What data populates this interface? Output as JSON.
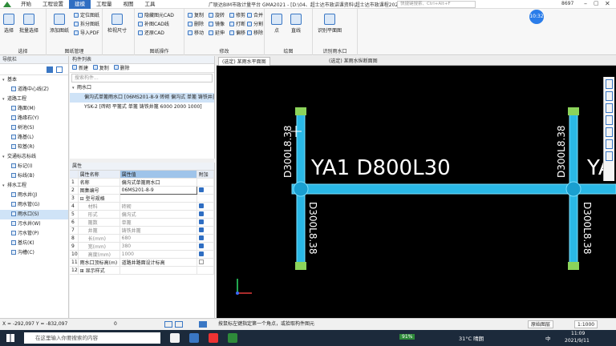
{
  "app": {
    "title": "广联达BIM市政计量平台 GMA2021 - [D:\\04、超士达市政讲课资料\\超士达市政课程2021-8-1\\纬五路管网工程.GMA]",
    "menus": [
      "开始",
      "工程设置",
      "建模",
      "工程量",
      "视图",
      "工具"
    ],
    "active_menu": "建模",
    "search_placeholder": "快捷键搜索、Ctrl+Alt+F",
    "user_id": "8697",
    "timer": "10:32"
  },
  "ribbon": {
    "groups": [
      {
        "label": "选择",
        "buttons": [
          "选择",
          "批量选择"
        ]
      },
      {
        "label": "图纸管理",
        "buttons": [
          "添加图纸",
          "定位图纸",
          "拆分图纸",
          "导入PDF"
        ]
      },
      {
        "label": "",
        "buttons": [
          "检视尺寸"
        ]
      },
      {
        "label": "图纸操作",
        "buttons": [
          "隐藏图元CAD",
          "补图CAD线",
          "还原CAD"
        ]
      },
      {
        "label": "修改",
        "buttons": [
          "复制",
          "旋转",
          "修剪",
          "合并",
          "删除",
          "镜像",
          "打断",
          "分割",
          "移动",
          "延伸",
          "偏移",
          "移除"
        ]
      },
      {
        "label": "绘图",
        "buttons": [
          "点",
          "直线"
        ]
      },
      {
        "label": "识别雨水口",
        "buttons": [
          "识别平面图"
        ]
      }
    ]
  },
  "nav": {
    "title": "导航栏",
    "items": [
      {
        "label": "基本",
        "level": 0
      },
      {
        "label": "道路中心线(Z)",
        "level": 1
      },
      {
        "label": "道路工程",
        "level": 0
      },
      {
        "label": "路面(M)",
        "level": 1
      },
      {
        "label": "路缘石(Y)",
        "level": 1
      },
      {
        "label": "树池(S)",
        "level": 1
      },
      {
        "label": "路基(L)",
        "level": 1
      },
      {
        "label": "软基(R)",
        "level": 1
      },
      {
        "label": "交通标志标线",
        "level": 0
      },
      {
        "label": "标记(I)",
        "level": 1
      },
      {
        "label": "标线(B)",
        "level": 1
      },
      {
        "label": "排水工程",
        "level": 0
      },
      {
        "label": "雨水井(J)",
        "level": 1
      },
      {
        "label": "雨水管(G)",
        "level": 1
      },
      {
        "label": "雨水口(S)",
        "level": 1,
        "selected": true
      },
      {
        "label": "污水井(W)",
        "level": 1
      },
      {
        "label": "污水管(P)",
        "level": 1
      },
      {
        "label": "基坑(K)",
        "level": 1
      },
      {
        "label": "沟槽(C)",
        "level": 1
      }
    ]
  },
  "component_list": {
    "title": "构件列表",
    "new_label": "新建",
    "copy_label": "复制",
    "delete_label": "删除",
    "search_placeholder": "搜索构件...",
    "group": "雨水口",
    "items": [
      {
        "label": "偏沟式单篦雨水口 [06MS201-8-9 砖砌 偏沟式 单篦 铸铁井盖",
        "selected": true
      },
      {
        "label": "YSK-2 [砖砌 平篦式 单篦 铸铁井篦 6000 2000 1000]",
        "selected": false
      }
    ]
  },
  "properties": {
    "title": "属性",
    "headers": [
      "属性名称",
      "属性值",
      "附加"
    ],
    "rows": [
      {
        "no": "1",
        "name": "名称",
        "value": "偏沟式单篦雨水口",
        "check": "none"
      },
      {
        "no": "2",
        "name": "图集编号",
        "value": "06MS201-8-9",
        "check": "on"
      },
      {
        "no": "3",
        "name": "⊟ 型号规格",
        "value": "",
        "check": "none"
      },
      {
        "no": "4",
        "name": "材料",
        "value": "砖砌",
        "check": "on"
      },
      {
        "no": "5",
        "name": "形式",
        "value": "偏沟式",
        "check": "on"
      },
      {
        "no": "6",
        "name": "篦数",
        "value": "单篦",
        "check": "on"
      },
      {
        "no": "7",
        "name": "井篦",
        "value": "铸铁井篦",
        "check": "on"
      },
      {
        "no": "8",
        "name": "长(mm)",
        "value": "680",
        "check": "on"
      },
      {
        "no": "9",
        "name": "宽(mm)",
        "value": "380",
        "check": "on"
      },
      {
        "no": "10",
        "name": "高度(mm)",
        "value": "1000",
        "check": "on"
      },
      {
        "no": "11",
        "name": "雨水口顶标高(m)",
        "value": "道路井路面设计标高",
        "check": "off"
      },
      {
        "no": "12",
        "name": "⊞ 显示样式",
        "value": "",
        "check": "none"
      }
    ]
  },
  "tabs": [
    {
      "label": "(选定) 某雨水平面图",
      "active": true
    },
    {
      "label": "(选定) 某雨水纵断面图",
      "active": false
    }
  ],
  "cad": {
    "text_pipe_label": "YA1  D800L30",
    "text_right_partial": "YA",
    "vertical_labels": [
      "D300L8.38",
      "D300L8.38",
      "D300L8.38",
      "D300L8.38"
    ],
    "colors": {
      "pipe": "#2ab8e6",
      "pipe_edge": "#7ae0ff",
      "marker": "#8bd35a",
      "bg": "#000000"
    }
  },
  "status": {
    "coords": "X = -292,097 Y = -832,097",
    "zero": "0",
    "hint": "按鼠标左键指定第一个角点，或拾取构件图元",
    "view": "原始图层",
    "scale": "1:1000"
  },
  "taskbar": {
    "search": "在这里输入你要搜索的内容",
    "temp": "31°C 晴朗",
    "time": "11:09",
    "date": "2021/9/11",
    "lang": "中",
    "battery": "91%"
  }
}
